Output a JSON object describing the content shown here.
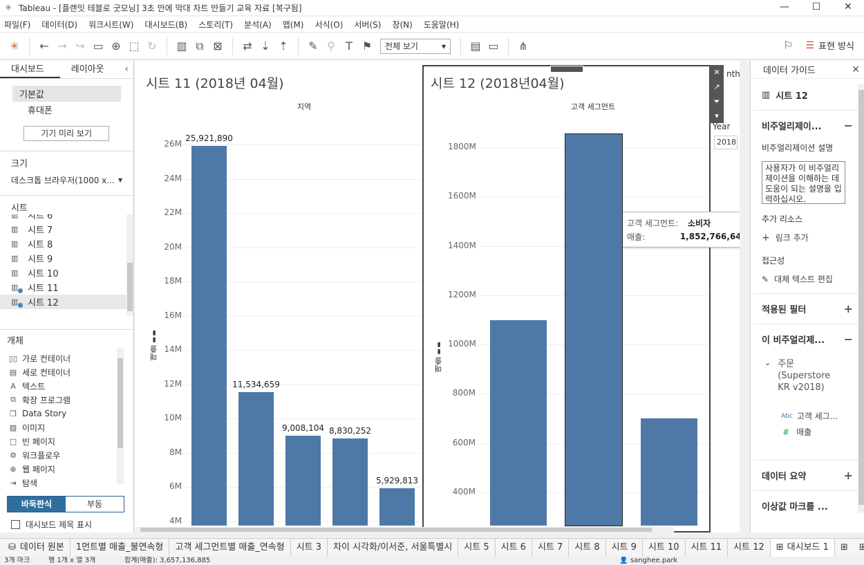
{
  "window": {
    "title": "Tableau - [플랜잇 테블로 굿모닝] 3초 만에 막대 차트 만들기 교육 자료 [복구됨]",
    "minimize": "—",
    "maximize": "☐",
    "close": "✕"
  },
  "menu": [
    "파일(F)",
    "데이터(D)",
    "워크시트(W)",
    "대시보드(B)",
    "스토리(T)",
    "분석(A)",
    "맵(M)",
    "서식(O)",
    "서버(S)",
    "창(N)",
    "도움말(H)"
  ],
  "toolbar": {
    "view_mode": "전체 보기",
    "show_me_label": "표현 방식"
  },
  "left_panel": {
    "tabs": [
      "대시보드",
      "레이아웃"
    ],
    "devices": [
      "기본값",
      "휴대폰"
    ],
    "device_preview_button": "기기 미리 보기",
    "size_heading": "크기",
    "size_value": "데스크톱 브라우저(1000 x...",
    "sheets_heading": "시트",
    "sheets": [
      "시트 6",
      "시트 7",
      "시트 8",
      "시트 9",
      "시트 10",
      "시트 11",
      "시트 12"
    ],
    "objects_heading": "개체",
    "objects": [
      {
        "icon": "horizontal-container-icon",
        "label": "가로 컨테이너"
      },
      {
        "icon": "vertical-container-icon",
        "label": "세로 컨테이너"
      },
      {
        "icon": "text-icon",
        "label": "텍스트"
      },
      {
        "icon": "extension-icon",
        "label": "확장 프로그램"
      },
      {
        "icon": "data-story-icon",
        "label": "Data Story"
      },
      {
        "icon": "image-icon",
        "label": "이미지"
      },
      {
        "icon": "blank-icon",
        "label": "빈 페이지"
      },
      {
        "icon": "workflow-icon",
        "label": "워크플로우"
      },
      {
        "icon": "web-page-icon",
        "label": "웹 페이지"
      },
      {
        "icon": "navigation-icon",
        "label": "탐색"
      }
    ],
    "tiled_label": "바둑판식",
    "floating_label": "부동",
    "show_dashboard_title": "대시보드 제목 표시"
  },
  "sheet11": {
    "title": "시트 11 (2018년 04월)",
    "column_header": "지역",
    "y_axis_label": "매출",
    "y_ticks": [
      "26M",
      "24M",
      "22M",
      "20M",
      "18M",
      "16M",
      "14M",
      "12M",
      "10M",
      "8M",
      "6M",
      "4M"
    ],
    "bar_labels": [
      "25,921,890",
      "11,534,659",
      "9,008,104",
      "8,830,252",
      "5,929,813"
    ]
  },
  "sheet12": {
    "title": "시트 12 (2018년04월)",
    "column_header": "고객 세그먼트",
    "y_axis_label": "매출",
    "y_ticks": [
      "1800M",
      "1600M",
      "1400M",
      "1200M",
      "1000M",
      "800M",
      "600M",
      "400M"
    ]
  },
  "filter_card": {
    "month_partial": "nth",
    "year_label": "Year",
    "year_value": "2018"
  },
  "tooltip": {
    "segment_key": "고객 세그먼트:",
    "segment_value": "소비자",
    "sales_key": "매출:",
    "sales_value": "1,852,766,648"
  },
  "right_panel": {
    "title": "데이터 가이드",
    "sheet_name": "시트 12",
    "viz_section": "비주얼리제이...",
    "viz_desc_label": "비주얼리제이션 설명",
    "viz_desc_placeholder": "사용자가 이 비주얼리제이션을 이해하는 데 도움이 되는 설명을 입력하십시오.",
    "extra_resources": "추가 리소스",
    "add_link": "링크 추가",
    "accessibility": "접근성",
    "edit_alt_text": "대체 텍스트 편집",
    "applied_filters": "적용된 필터",
    "this_viz": "이 비주얼리제...",
    "datasource_name": "주문 (Superstore KR v2018)",
    "field_dimension": "고객 세그...",
    "field_measure": "매출",
    "data_summary": "데이터 요약",
    "outlier_marks": "이상값 마크를 ..."
  },
  "sheet_tabs": {
    "datasource": "데이터 원본",
    "tabs": [
      "1먼트별 매출_불연속형",
      "고객 세그먼트별 매출_연속형",
      "시트 3",
      "차이 시각화/이서준, 서울특별시",
      "시트 5",
      "시트 6",
      "시트 7",
      "시트 8",
      "시트 9",
      "시트 10",
      "시트 11",
      "시트 12"
    ],
    "active_dashboard": "대시보드 1"
  },
  "status_bar": {
    "marks": "3개 마크",
    "rows_cols": "행 1개 x 열 3개",
    "sum": "합계(매출): 3,657,136,885",
    "user": "sanghee.park"
  },
  "chart_data": [
    {
      "type": "bar",
      "title": "시트 11 (2018년 04월)",
      "xlabel": "지역",
      "ylabel": "매출",
      "categories": [
        "",
        "",
        "",
        "",
        ""
      ],
      "values": [
        25921890,
        11534659,
        9008104,
        8830252,
        5929813
      ],
      "ylim": [
        4000000,
        26000000
      ]
    },
    {
      "type": "bar",
      "title": "시트 12 (2018년04월)",
      "xlabel": "고객 세그먼트",
      "ylabel": "매출",
      "categories": [
        "",
        "소비자",
        ""
      ],
      "values": [
        1100000000,
        1852766648,
        700000000
      ],
      "ylim": [
        400000000,
        1800000000
      ]
    }
  ],
  "colors": {
    "bar": "#4e79a7",
    "tiled_active": "#2e6fa0"
  }
}
